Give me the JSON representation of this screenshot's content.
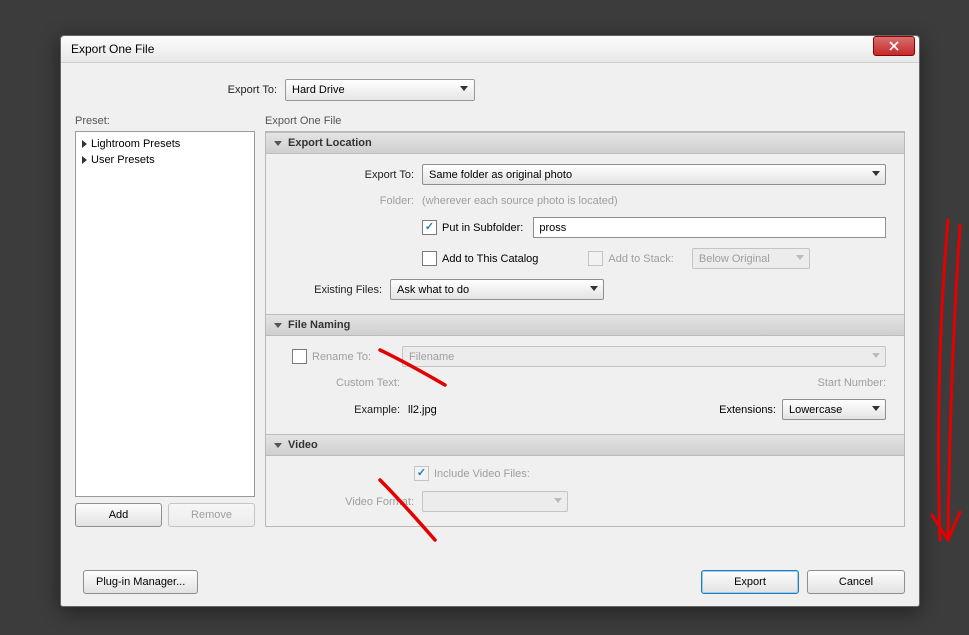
{
  "title": "Export One File",
  "exportTo": {
    "label": "Export To:",
    "value": "Hard Drive"
  },
  "presetLabel": "Preset:",
  "presets": {
    "items": [
      "Lightroom Presets",
      "User Presets"
    ]
  },
  "addBtn": "Add",
  "removeBtn": "Remove",
  "rightTitle": "Export One File",
  "sections": {
    "location": {
      "title": "Export Location",
      "exportTo": {
        "label": "Export To:",
        "value": "Same folder as original photo"
      },
      "folder": {
        "label": "Folder:",
        "value": "(wherever each source photo is located)"
      },
      "putSub": {
        "label": "Put in Subfolder:",
        "value": "pross"
      },
      "addCatalog": "Add to This Catalog",
      "addStack": "Add to Stack:",
      "stackPos": "Below Original",
      "existing": {
        "label": "Existing Files:",
        "value": "Ask what to do"
      }
    },
    "naming": {
      "title": "File Naming",
      "rename": "Rename To:",
      "template": "Filename",
      "customText": "Custom Text:",
      "startNum": "Start Number:",
      "example": {
        "label": "Example:",
        "value": "ll2.jpg"
      },
      "extensions": {
        "label": "Extensions:",
        "value": "Lowercase"
      }
    },
    "video": {
      "title": "Video",
      "include": "Include Video Files:",
      "format": "Video Format:"
    }
  },
  "pluginMgr": "Plug-in Manager...",
  "exportBtn": "Export",
  "cancelBtn": "Cancel"
}
